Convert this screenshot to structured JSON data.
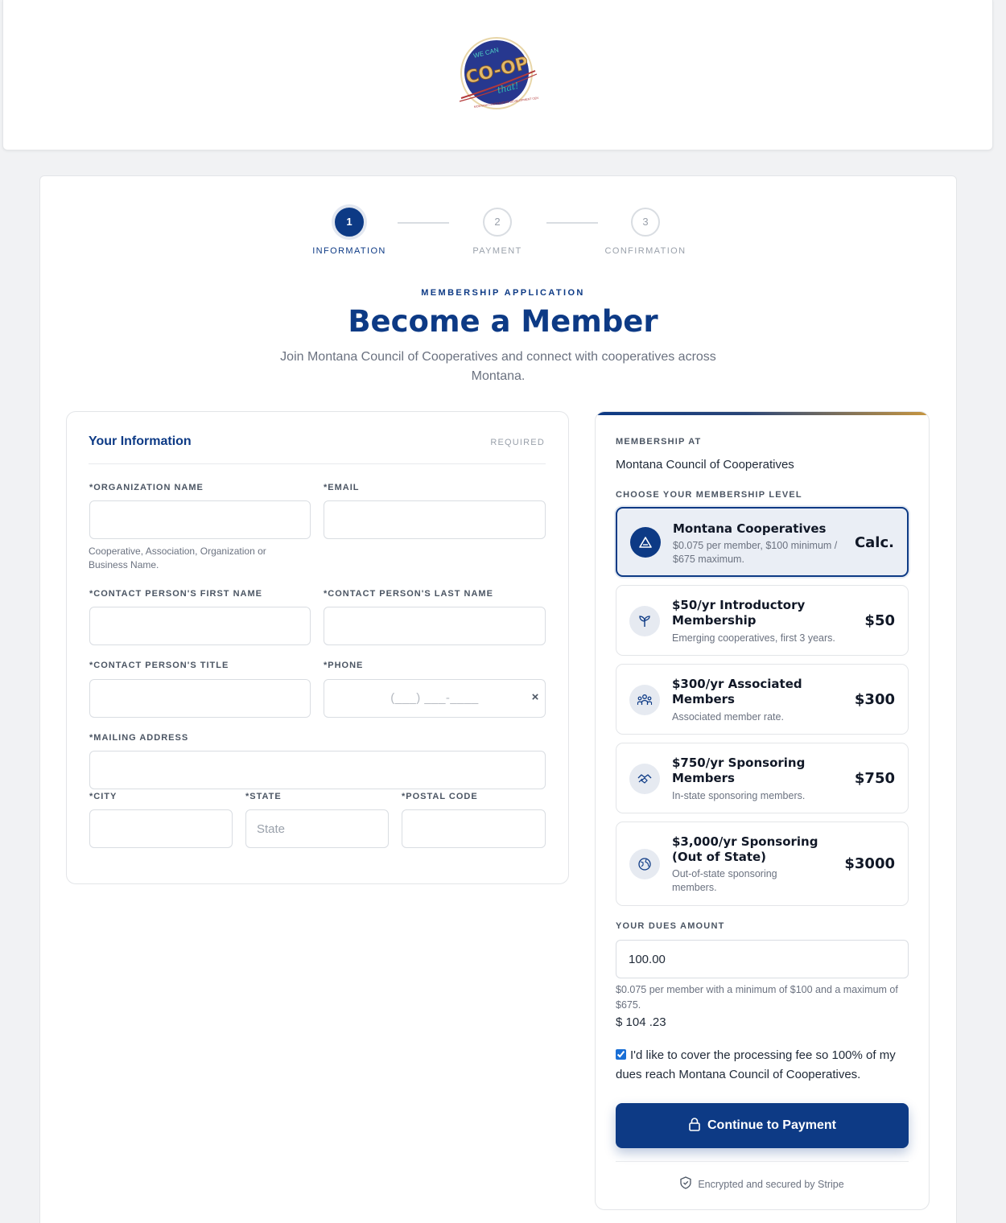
{
  "header": {
    "logo_text": "WE CAN CO-OP that!",
    "logo_ring_text": "MONTANA COOPERATIVE DEVELOPMENT CENTER"
  },
  "stepper": {
    "steps": [
      {
        "number": "1",
        "label": "INFORMATION",
        "state": "active"
      },
      {
        "number": "2",
        "label": "PAYMENT",
        "state": "upcoming"
      },
      {
        "number": "3",
        "label": "CONFIRMATION",
        "state": "upcoming"
      }
    ]
  },
  "intro": {
    "eyebrow": "MEMBERSHIP APPLICATION",
    "title": "Become a Member",
    "subtitle": "Join Montana Council of Cooperatives and connect with cooperatives across Montana."
  },
  "form": {
    "title": "Your Information",
    "required_label": "REQUIRED",
    "org_name_label": "*ORGANIZATION NAME",
    "org_name_value": "",
    "org_name_help": "Cooperative, Association, Organization or Business Name.",
    "email_label": "*EMAIL",
    "email_value": "",
    "first_name_label": "*CONTACT PERSON'S FIRST NAME",
    "first_name_value": "",
    "last_name_label": "*CONTACT PERSON'S LAST NAME",
    "last_name_value": "",
    "title_label": "*CONTACT PERSON'S TITLE",
    "title_value": "",
    "phone_label": "*PHONE",
    "phone_mask": "(___) ___-____",
    "phone_clear": "×",
    "address_label": "*MAILING ADDRESS",
    "address_value": "",
    "city_label": "*CITY",
    "city_value": "",
    "state_label": "*STATE",
    "state_placeholder": "State",
    "postal_label": "*POSTAL CODE",
    "postal_value": ""
  },
  "summary": {
    "membership_at_label": "MEMBERSHIP AT",
    "organization": "Montana Council of Cooperatives",
    "choose_label": "CHOOSE YOUR MEMBERSHIP LEVEL",
    "tiers": [
      {
        "name": "Montana Cooperatives",
        "desc": "$0.075 per member, $100 minimum / $675 maximum.",
        "price": "Calc.",
        "icon": "mountain-icon",
        "selected": true
      },
      {
        "name": "$50/yr Introductory Membership",
        "desc": "Emerging cooperatives, first 3 years.",
        "price": "$50",
        "icon": "sprout-icon",
        "selected": false
      },
      {
        "name": "$300/yr Associated Members",
        "desc": "Associated member rate.",
        "price": "$300",
        "icon": "group-icon",
        "selected": false
      },
      {
        "name": "$750/yr Sponsoring Members",
        "desc": "In-state sponsoring members.",
        "price": "$750",
        "icon": "handshake-icon",
        "selected": false
      },
      {
        "name": "$3,000/yr Sponsoring (Out of State)",
        "desc": "Out-of-state sponsoring members.",
        "price": "$3000",
        "icon": "globe-icon",
        "selected": false
      }
    ],
    "dues_label": "YOUR DUES AMOUNT",
    "dues_value": "100.00",
    "dues_help": "$0.075 per member with a minimum of $100 and a maximum of $675.",
    "dues_total": "$ 104 .23",
    "fee_checked": true,
    "fee_text": "I'd like to cover the processing fee so 100% of my dues reach Montana Council of Cooperatives.",
    "continue_label": "Continue to Payment",
    "secure_text": "Encrypted and secured by Stripe"
  },
  "colors": {
    "brand": "#0d3a85",
    "accent_gold": "#c79640"
  }
}
